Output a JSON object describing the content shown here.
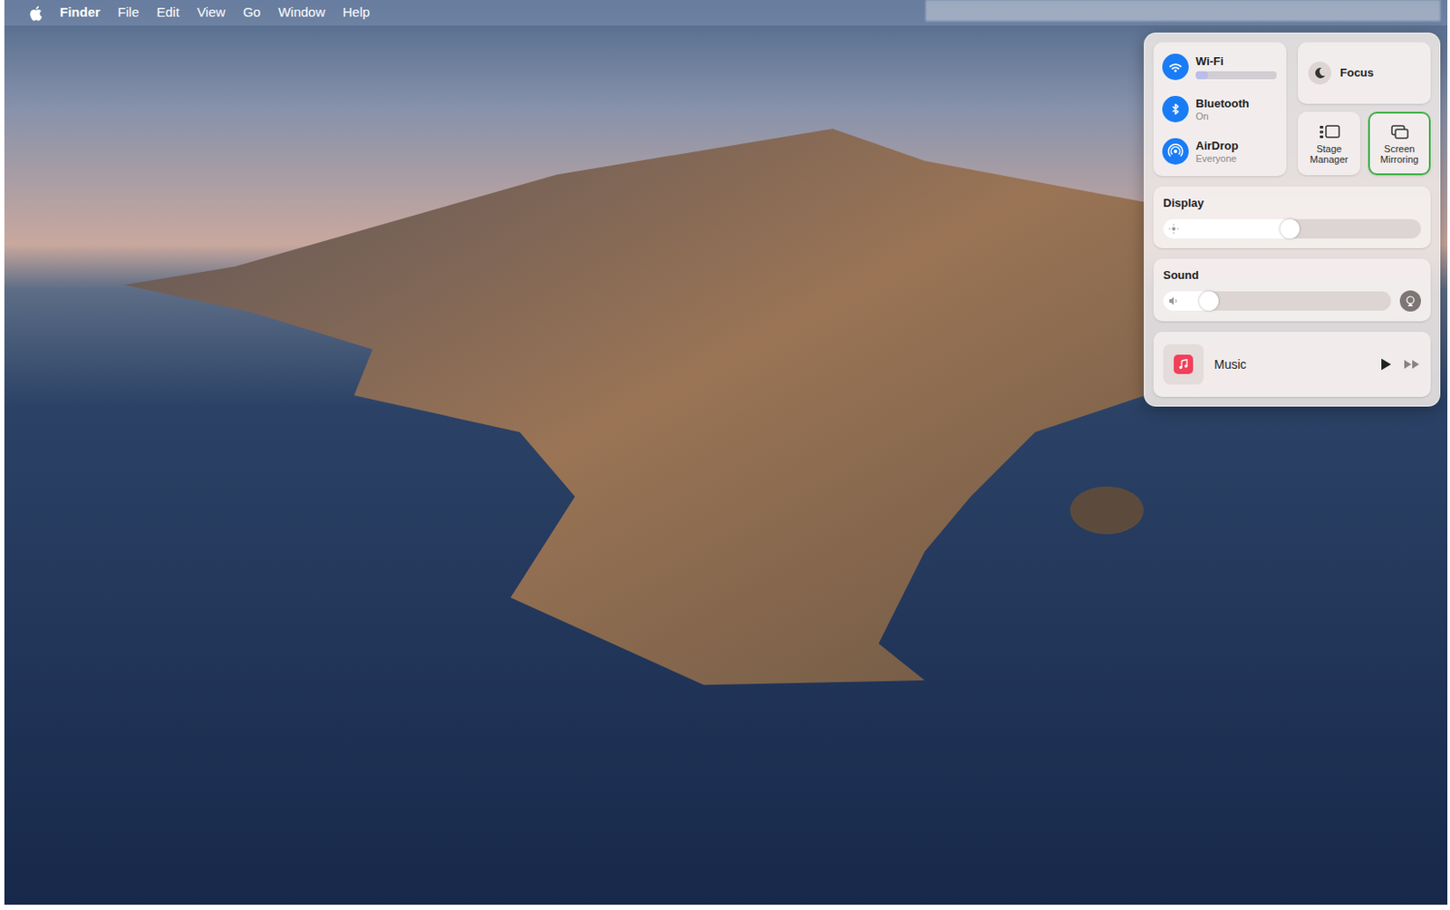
{
  "menu_bar": {
    "app_name": "Finder",
    "menus": [
      "File",
      "Edit",
      "View",
      "Go",
      "Window",
      "Help"
    ]
  },
  "control_center": {
    "connectivity": [
      {
        "label": "Wi-Fi",
        "status": "",
        "status_redacted": true,
        "on": true
      },
      {
        "label": "Bluetooth",
        "status": "On",
        "status_redacted": false,
        "on": true
      },
      {
        "label": "AirDrop",
        "status": "Everyone",
        "status_redacted": false,
        "on": true
      }
    ],
    "focus": {
      "label": "Focus"
    },
    "tiles": [
      {
        "label": "Stage Manager",
        "highlighted": false
      },
      {
        "label": "Screen Mirroring",
        "highlighted": true
      }
    ],
    "display": {
      "label": "Display",
      "level": 0.49
    },
    "sound": {
      "label": "Sound",
      "level": 0.2
    },
    "now_playing": {
      "app": "Music",
      "playing": false
    }
  }
}
